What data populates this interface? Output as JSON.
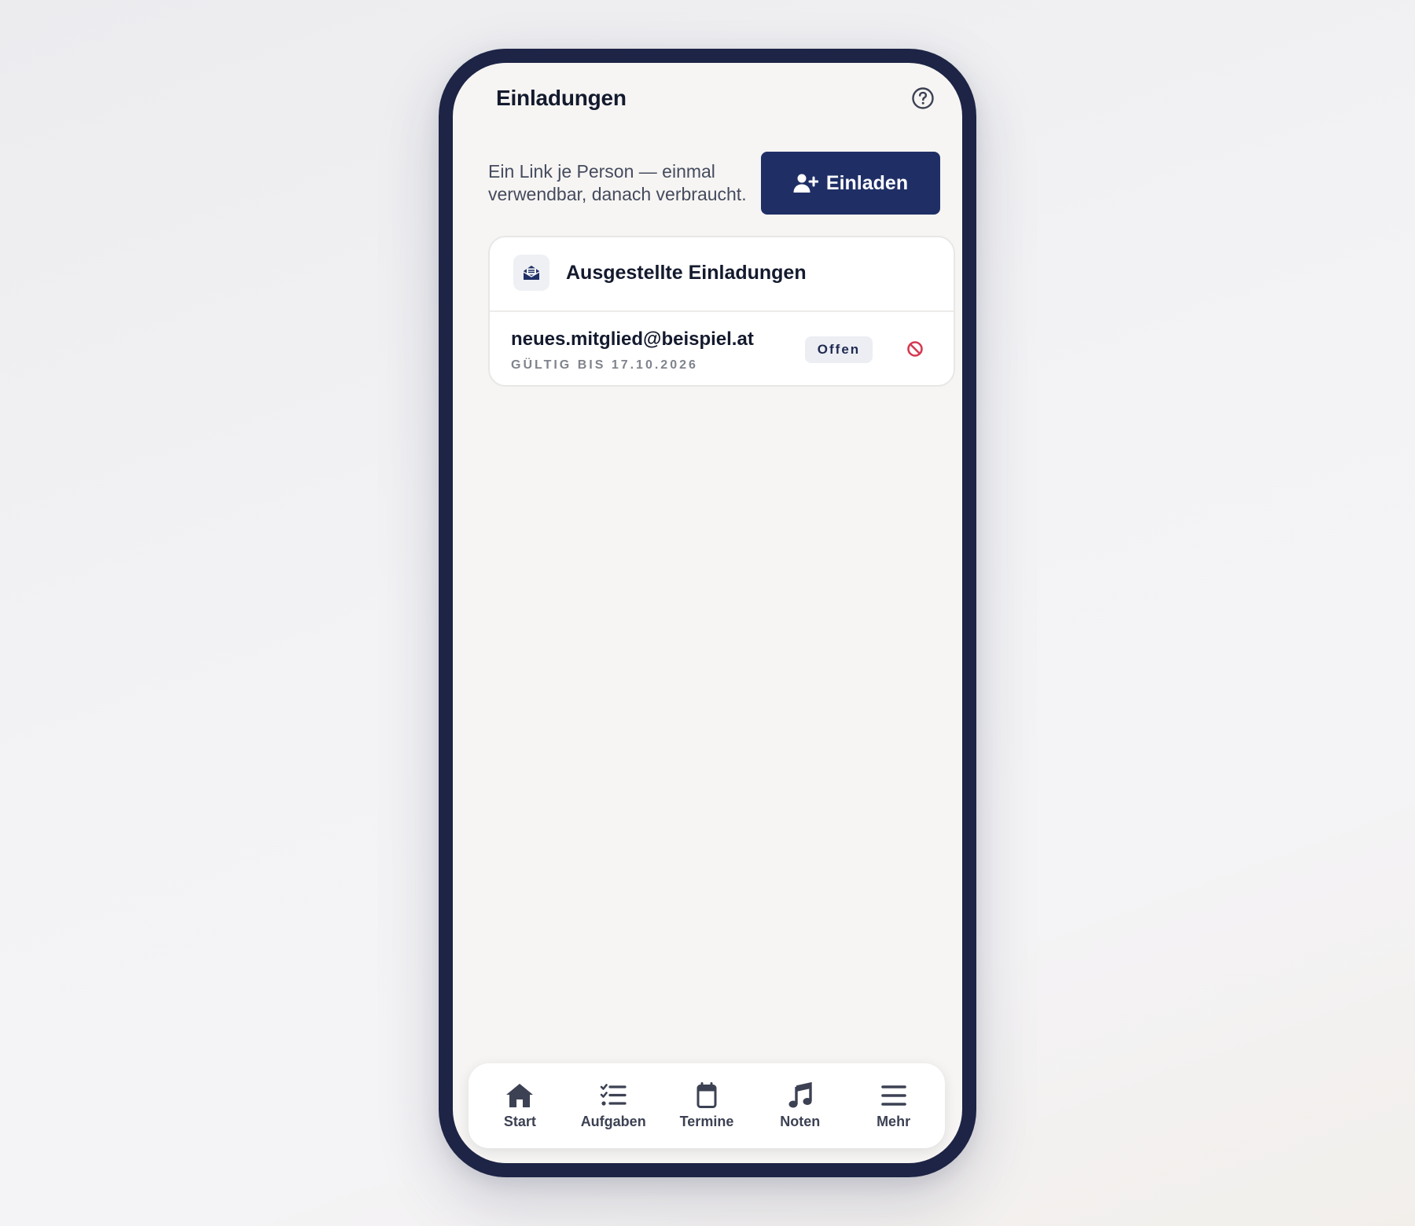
{
  "header": {
    "title": "Einladungen",
    "help_icon": "question-circle-icon"
  },
  "intro": {
    "text": "Ein Link je Person — einmal verwendbar, danach verbraucht."
  },
  "invite_button": {
    "label": "Einladen",
    "icon": "user-plus-icon"
  },
  "invitations": {
    "title": "Ausgestellte Einladungen",
    "icon": "envelope-open-icon",
    "items": [
      {
        "email": "neues.mitglied@beispiel.at",
        "valid_until": "GÜLTIG BIS 17.10.2026",
        "status": "Offen",
        "revoke_icon": "ban-icon"
      }
    ]
  },
  "tabbar": {
    "items": [
      {
        "label": "Start",
        "icon": "home-icon"
      },
      {
        "label": "Aufgaben",
        "icon": "checklist-icon"
      },
      {
        "label": "Termine",
        "icon": "calendar-icon"
      },
      {
        "label": "Noten",
        "icon": "music-note-icon"
      },
      {
        "label": "Mehr",
        "icon": "menu-icon"
      }
    ]
  },
  "colors": {
    "primary": "#1f2f66",
    "frame": "#1d2445",
    "screen_bg": "#f6f5f3",
    "revoke": "#d43a52",
    "badge_bg": "#eceef3"
  }
}
